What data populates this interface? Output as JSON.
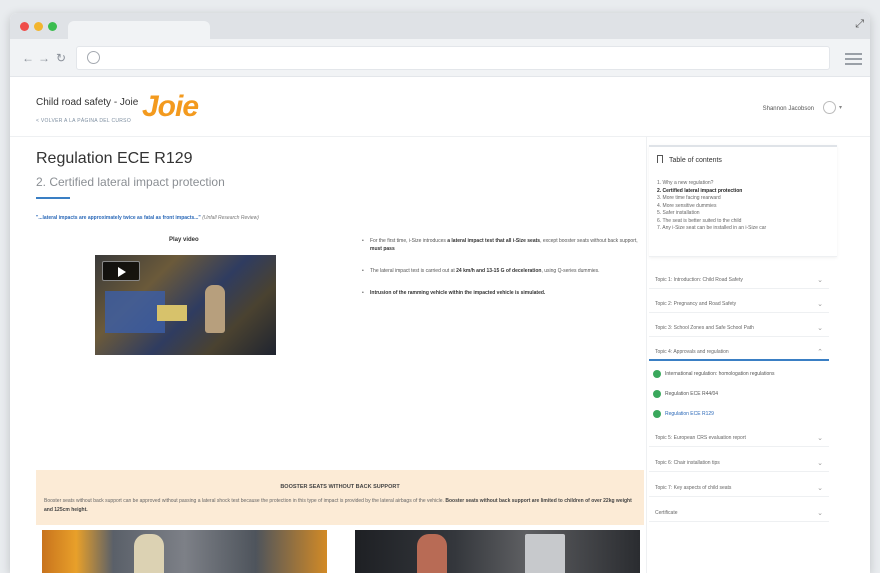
{
  "browser": {
    "url": ""
  },
  "header": {
    "course_title": "Child road safety - Joie",
    "back_link": "< VOLVER A LA PÁGINA DEL CURSO",
    "logo": "Joie",
    "user_name": "Shannon Jacobson"
  },
  "main": {
    "title": "Regulation ECE R129",
    "subtitle": "2. Certified lateral impact protection",
    "quote": "\"...lateral impacts are approximately twice as fatal as front impacts...\"",
    "quote_source": "(Unfall Research Review)",
    "video_label": "Play video",
    "bullets": [
      {
        "pre": "For the first time, i-Size introduces ",
        "bold": "a lateral impact test that all i-Size seats",
        "post": ", except booster seats without back support, ",
        "bold2": "must pass"
      },
      {
        "pre": "The lateral impact test is carried out at ",
        "bold": "24 km/h and 13-15 G of deceleration",
        "post": ", using Q-series dummies.",
        "bold2": ""
      },
      {
        "pre": "",
        "bold": "Intrusion of the ramming vehicle within the impacted vehicle is simulated.",
        "post": "",
        "bold2": ""
      }
    ],
    "alert": {
      "title": "BOOSTER SEATS WITHOUT BACK SUPPORT",
      "text": "Booster seats without back support can be approved without passing a lateral shock test because the protection in this type of impact is provided by the lateral airbags of the vehicle. ",
      "bold": "Booster seats without back support are limited to children of over 22kg weight and 125cm height."
    }
  },
  "toc": {
    "title": "Table of contents",
    "items": [
      {
        "label": "1. Why a new regulation?",
        "active": false
      },
      {
        "label": "2. Certified lateral impact protection",
        "active": true
      },
      {
        "label": "3. More time facing rearward",
        "active": false
      },
      {
        "label": "4. More sensitive dummies",
        "active": false
      },
      {
        "label": "5. Safer installation",
        "active": false
      },
      {
        "label": "6. The seat is better suited to the child",
        "active": false
      },
      {
        "label": "7. Any i-Size seat can be installed in an i-Size car",
        "active": false
      }
    ]
  },
  "topics": {
    "t1": "Topic 1: Introduction: Child Road Safety",
    "t2": "Topic 2: Pregnancy and Road Safety",
    "t3": "Topic 3: School Zones and Safe School Path",
    "t4": "Topic 4: Approvals and regulation",
    "sub1": "International regulation: homologation regulations",
    "sub2": "Regulation ECE R44/04",
    "sub3": "Regulation ECE R129",
    "t5": "Topic 5: European CRS evaluation report",
    "t6": "Topic 6: Chair installation tips",
    "t7": "Topic 7: Key aspects of child seats",
    "t8": "Certificate"
  },
  "colors": {
    "accent": "#3a7fc4",
    "brand": "#f39a1e",
    "alert_bg": "#fcebd6",
    "done": "#3aa85c"
  }
}
